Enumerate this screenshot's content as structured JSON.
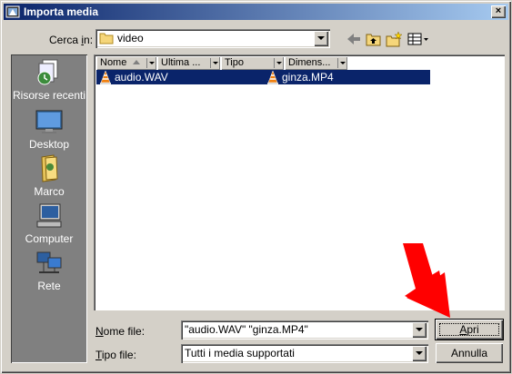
{
  "window": {
    "title": "Importa media",
    "close_glyph": "×"
  },
  "look_in": {
    "label_pre": "Cerca ",
    "label_key": "i",
    "label_post": "n:",
    "value": "video"
  },
  "toolbar": {
    "icons": [
      "back-arrow-icon",
      "up-folder-icon",
      "new-folder-icon",
      "view-menu-icon"
    ]
  },
  "places": [
    {
      "label": "Risorse recenti",
      "icon": "recent-docs-icon"
    },
    {
      "label": "Desktop",
      "icon": "desktop-icon"
    },
    {
      "label": "Marco",
      "icon": "user-folder-icon"
    },
    {
      "label": "Computer",
      "icon": "computer-icon"
    },
    {
      "label": "Rete",
      "icon": "network-icon"
    }
  ],
  "columns": [
    "Nome",
    "Ultima ...",
    "Tipo",
    "Dimens..."
  ],
  "files": [
    {
      "name": "audio.WAV",
      "icon": "vlc-cone-icon"
    },
    {
      "name": "ginza.MP4",
      "icon": "vlc-cone-icon"
    }
  ],
  "file_name": {
    "label_key": "N",
    "label_rest": "ome file:",
    "value": "\"audio.WAV\" \"ginza.MP4\""
  },
  "file_type": {
    "label_key": "T",
    "label_rest": "ipo file:",
    "value": "Tutti i media supportati"
  },
  "buttons": {
    "open_key": "A",
    "open_rest": "pri",
    "cancel": "Annulla"
  },
  "annotation": {
    "icon": "red-arrow-icon",
    "color": "#ff0000"
  },
  "colors": {
    "title_start": "#0a246a",
    "title_end": "#a6caf0",
    "face": "#d4d0c8",
    "selection": "#0a246a"
  }
}
